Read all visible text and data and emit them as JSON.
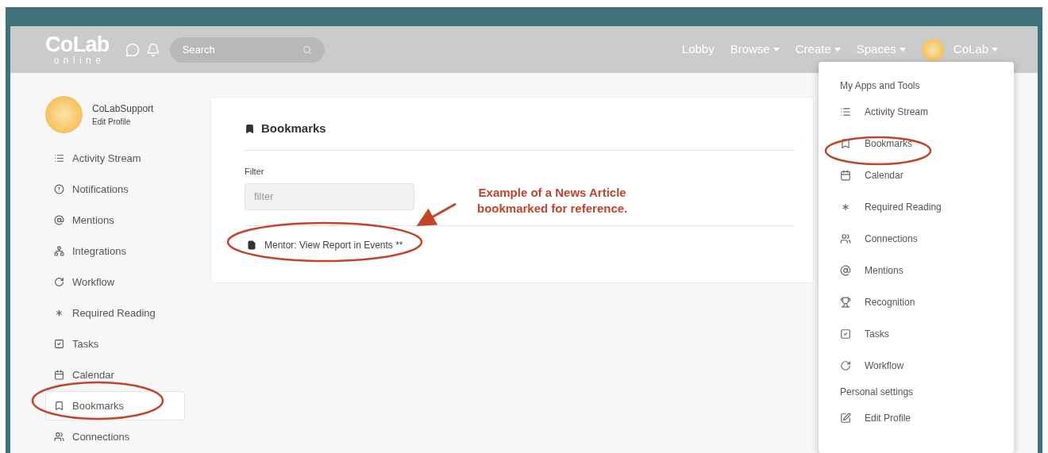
{
  "navbar": {
    "logo": {
      "word": "CoLab",
      "sub": "online"
    },
    "search": {
      "placeholder": "Search"
    },
    "links": [
      {
        "label": "Lobby",
        "dropdown": false
      },
      {
        "label": "Browse",
        "dropdown": true
      },
      {
        "label": "Create",
        "dropdown": true
      },
      {
        "label": "Spaces",
        "dropdown": true
      }
    ],
    "user": {
      "label": "CoLab",
      "expanded": true
    }
  },
  "sidebar": {
    "profile": {
      "name": "CoLabSupport",
      "link": "Edit Profile"
    },
    "items": [
      {
        "label": "Activity Stream",
        "selected": false
      },
      {
        "label": "Notifications",
        "selected": false
      },
      {
        "label": "Mentions",
        "selected": false
      },
      {
        "label": "Integrations",
        "selected": false
      },
      {
        "label": "Workflow",
        "selected": false
      },
      {
        "label": "Required Reading",
        "selected": false
      },
      {
        "label": "Tasks",
        "selected": false
      },
      {
        "label": "Calendar",
        "selected": false
      },
      {
        "label": "Bookmarks",
        "selected": true
      },
      {
        "label": "Connections",
        "selected": false
      }
    ]
  },
  "main": {
    "title": "Bookmarks",
    "filter": {
      "label": "Filter",
      "placeholder": "filter"
    },
    "bookmarks": [
      {
        "label": "Mentor: View Report in Events **"
      }
    ]
  },
  "annotation": {
    "lines": [
      "Example of a News Article",
      "bookmarked for reference."
    ]
  },
  "user_menu": {
    "sections": [
      {
        "header": "My Apps and Tools",
        "items": [
          {
            "label": "Activity Stream"
          },
          {
            "label": "Bookmarks"
          },
          {
            "label": "Calendar"
          },
          {
            "label": "Required Reading"
          },
          {
            "label": "Connections"
          },
          {
            "label": "Mentions"
          },
          {
            "label": "Recognition"
          },
          {
            "label": "Tasks"
          },
          {
            "label": "Workflow"
          }
        ]
      },
      {
        "header": "Personal settings",
        "items": [
          {
            "label": "Edit Profile"
          }
        ]
      }
    ]
  }
}
